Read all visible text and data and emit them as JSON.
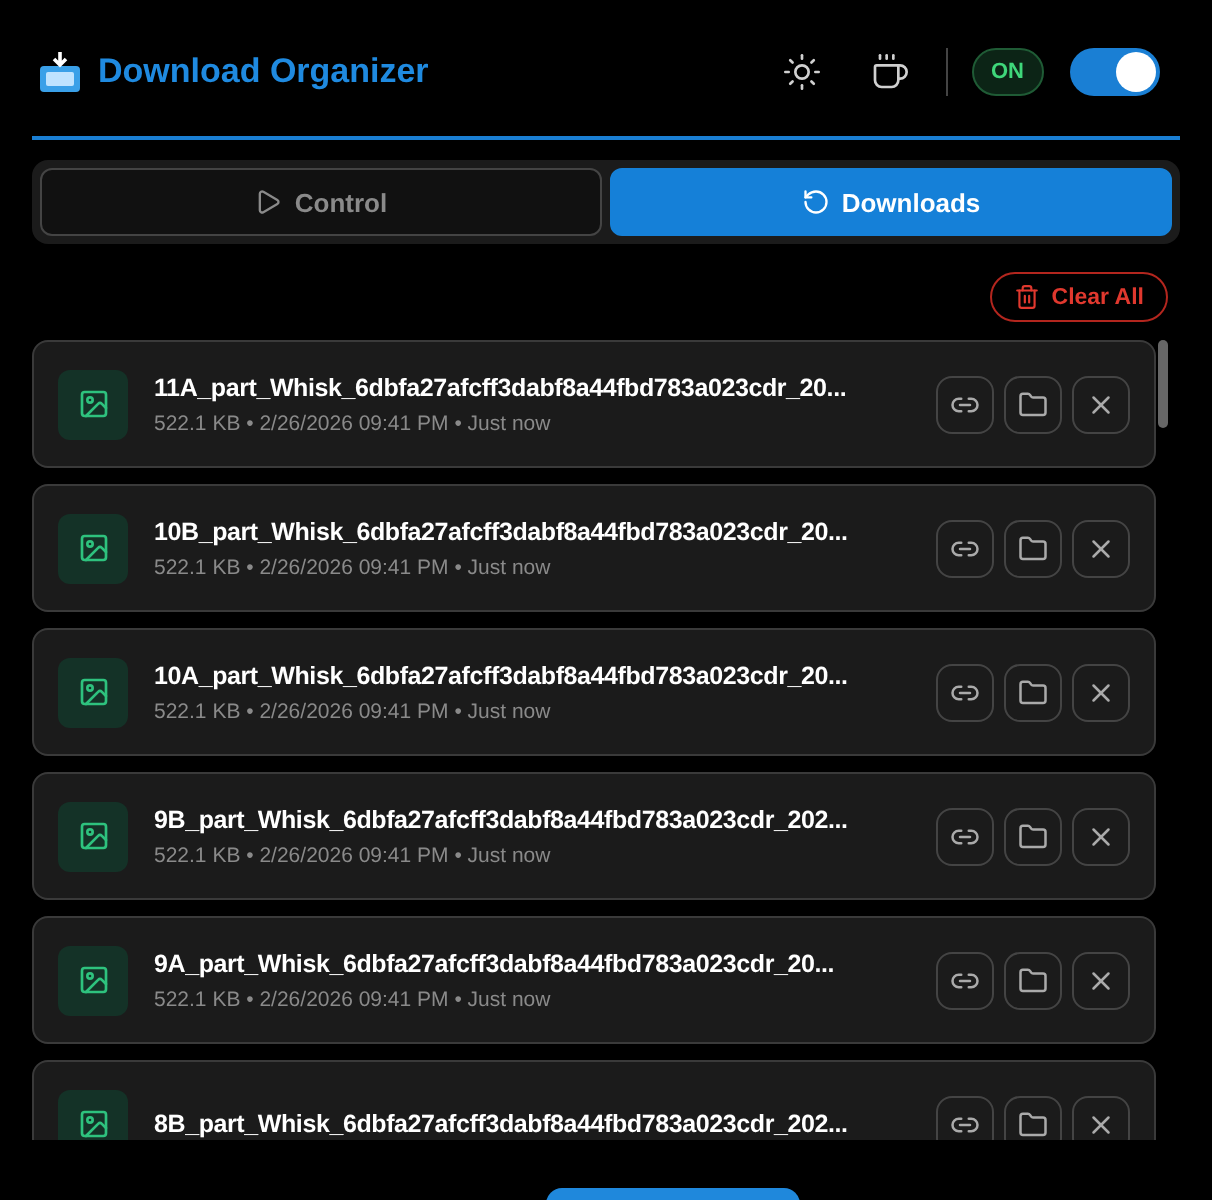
{
  "header": {
    "title": "Download Organizer",
    "badge": "ON",
    "power_toggle": {
      "on": true
    }
  },
  "tabs": [
    {
      "label": "Control",
      "selected": false,
      "kind": "play"
    },
    {
      "label": "Downloads",
      "selected": true,
      "kind": "history"
    }
  ],
  "clear_button": "Clear All",
  "downloads": [
    {
      "name": "11A_part_Whisk_6dbfa27afcff3dabf8a44fbd783a023cdr_20...",
      "details": "522.1 KB • 2/26/2026 09:41 PM • Just now"
    },
    {
      "name": "10B_part_Whisk_6dbfa27afcff3dabf8a44fbd783a023cdr_20...",
      "details": "522.1 KB • 2/26/2026 09:41 PM • Just now"
    },
    {
      "name": "10A_part_Whisk_6dbfa27afcff3dabf8a44fbd783a023cdr_20...",
      "details": "522.1 KB • 2/26/2026 09:41 PM • Just now"
    },
    {
      "name": "9B_part_Whisk_6dbfa27afcff3dabf8a44fbd783a023cdr_202...",
      "details": "522.1 KB • 2/26/2026 09:41 PM • Just now"
    },
    {
      "name": "9A_part_Whisk_6dbfa27afcff3dabf8a44fbd783a023cdr_20...",
      "details": "522.1 KB • 2/26/2026 09:41 PM • Just now"
    },
    {
      "name": "8B_part_Whisk_6dbfa27afcff3dabf8a44fbd783a023cdr_202..."
    }
  ]
}
